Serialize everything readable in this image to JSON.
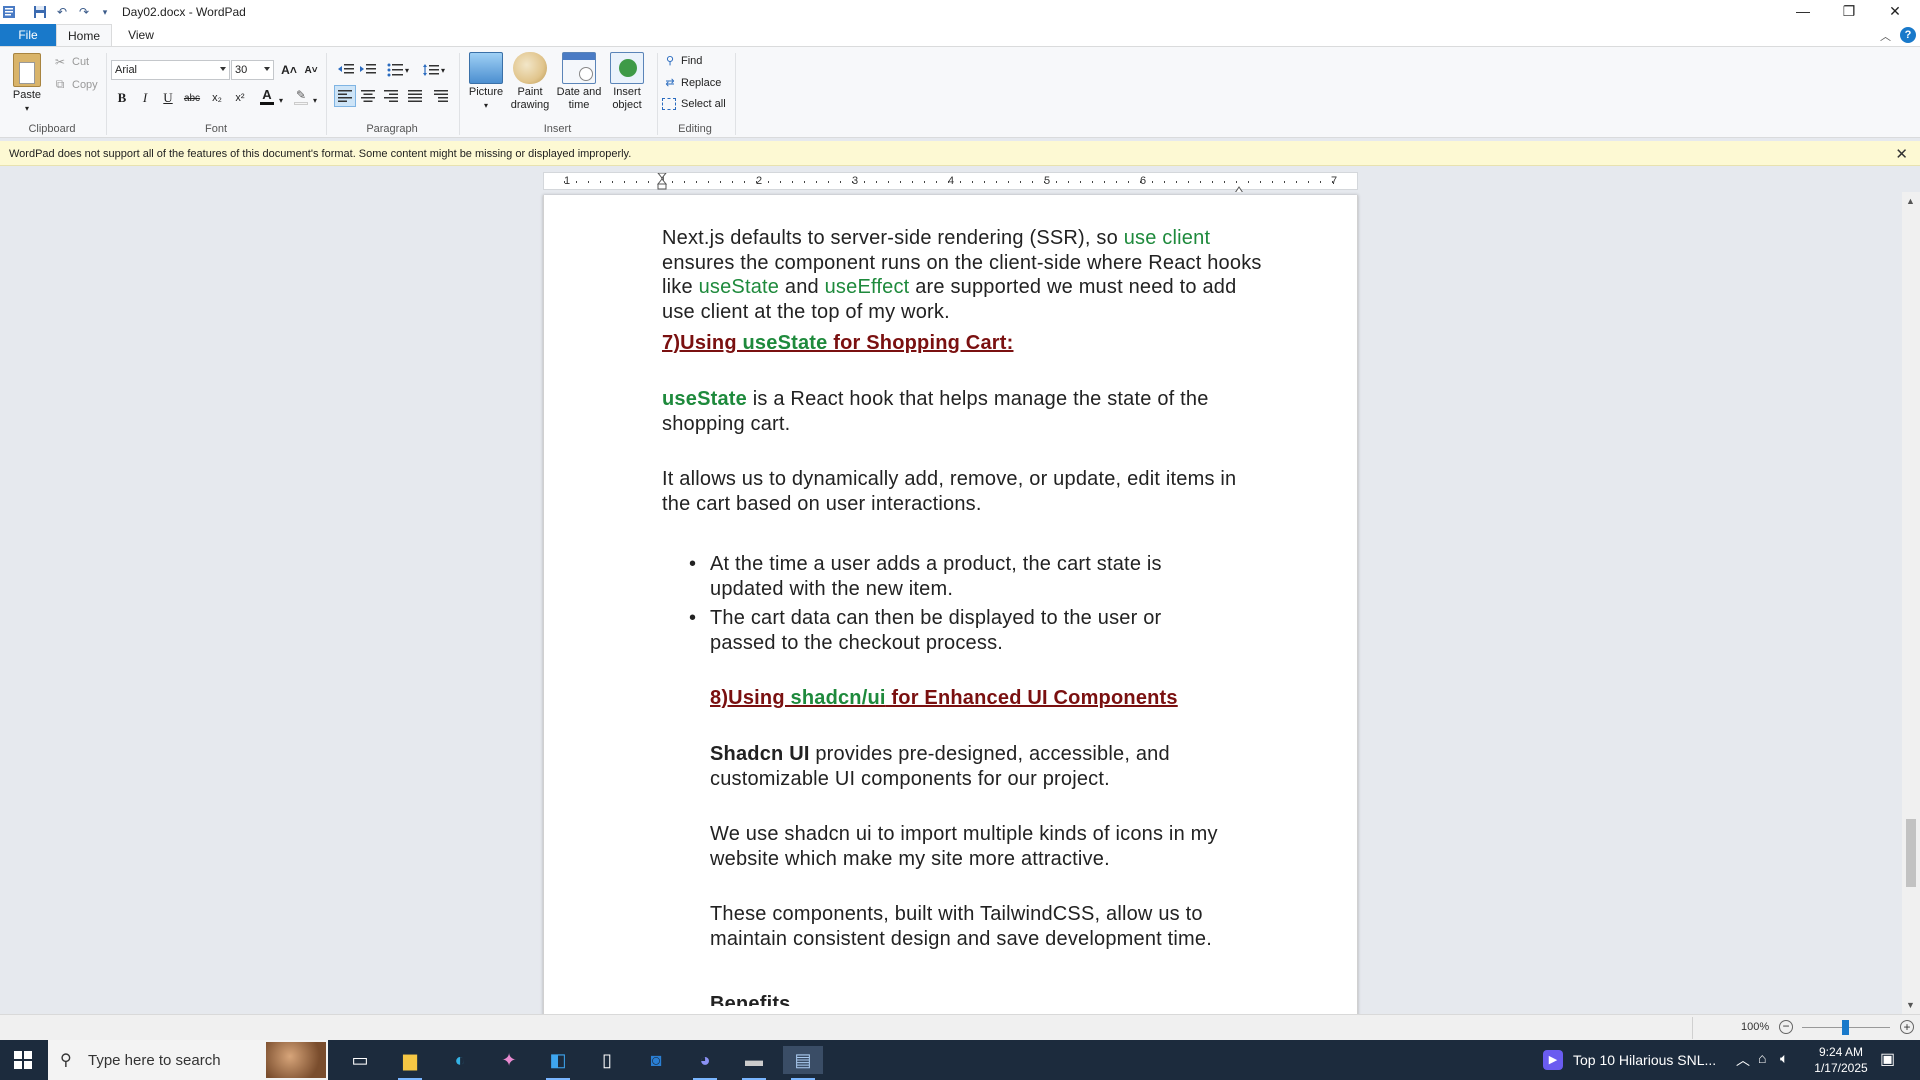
{
  "window": {
    "title": "Day02.docx - WordPad",
    "minimize_glyph": "—",
    "restore_glyph": "❐",
    "close_glyph": "✕"
  },
  "tabs": {
    "file": "File",
    "home": "Home",
    "view": "View"
  },
  "ribbon": {
    "clipboard": {
      "paste": "Paste",
      "cut": "Cut",
      "copy": "Copy",
      "label": "Clipboard"
    },
    "font": {
      "name": "Arial",
      "size": "30",
      "grow": "A˄",
      "shrink": "A˅",
      "bold": "B",
      "italic": "I",
      "underline": "U",
      "strike": "abc",
      "subscript": "x₂",
      "superscript": "x²",
      "color_a": "A",
      "label": "Font"
    },
    "paragraph": {
      "label": "Paragraph"
    },
    "insert": {
      "picture": "Picture",
      "paint_drawing": [
        "Paint",
        "drawing"
      ],
      "date_time": [
        "Date and",
        "time"
      ],
      "insert_object": [
        "Insert",
        "object"
      ],
      "label": "Insert"
    },
    "editing": {
      "find": "Find",
      "replace": "Replace",
      "select_all": "Select all",
      "label": "Editing"
    }
  },
  "infobar": {
    "message": "WordPad does not support all of the features of this document's format. Some content might be missing or displayed improperly.",
    "close": "✕"
  },
  "ruler": {
    "numbers": [
      "1",
      "2",
      "3",
      "4",
      "5",
      "6",
      "7"
    ]
  },
  "document": {
    "p1": {
      "a": "Next.js defaults to server-side rendering (SSR), so ",
      "g1": "use client",
      "b": " ensures the component runs on the client-side where React hooks like ",
      "g2": "useState",
      "c": " and ",
      "g3": "useEffect",
      "d": " are supported we must need to add use client at the top of my work."
    },
    "h7": {
      "a": "7)Using ",
      "g": "useState",
      "b": " for Shopping Cart:"
    },
    "p2": {
      "g": "useState",
      "rest": " is a React hook that helps manage the state of the shopping cart."
    },
    "p3": "It allows us to dynamically add, remove, or update, edit items in the cart based on user interactions.",
    "bullets": [
      "At the  time a user adds a product, the cart state is updated with the new item.",
      "The cart data can then be displayed to the user or passed to the checkout process."
    ],
    "h8": {
      "a": "8)Using ",
      "g": "shadcn/ui",
      "b": " for Enhanced UI Components"
    },
    "p4": {
      "bold": "Shadcn UI",
      "rest": " provides pre-designed, accessible, and customizable UI components for our project."
    },
    "p5": "We use shadcn ui to import multiple kinds of icons in my website which make my site more attractive.",
    "p6": "These components, built with TailwindCSS, allow us to maintain consistent design and save development time.",
    "p7_partial": "Benefits"
  },
  "statusbar": {
    "zoom": "100%"
  },
  "taskbar": {
    "search_placeholder": "Type here to search",
    "news": "Top 10 Hilarious SNL...",
    "time": "9:24 AM",
    "date": "1/17/2025",
    "icons": [
      "windows-icon",
      "task-view-icon",
      "file-explorer-icon",
      "edge-icon",
      "copilot-icon",
      "vscode-icon",
      "notepad-icon",
      "outlook-icon",
      "discord-icon",
      "terminal-icon",
      "wordpad-icon"
    ]
  },
  "colors": {
    "accent": "#1979ca",
    "heading": "#7a1010",
    "green": "#1e8a3c",
    "taskbar": "#1c2b3d",
    "infobar": "#fdf9d3"
  }
}
